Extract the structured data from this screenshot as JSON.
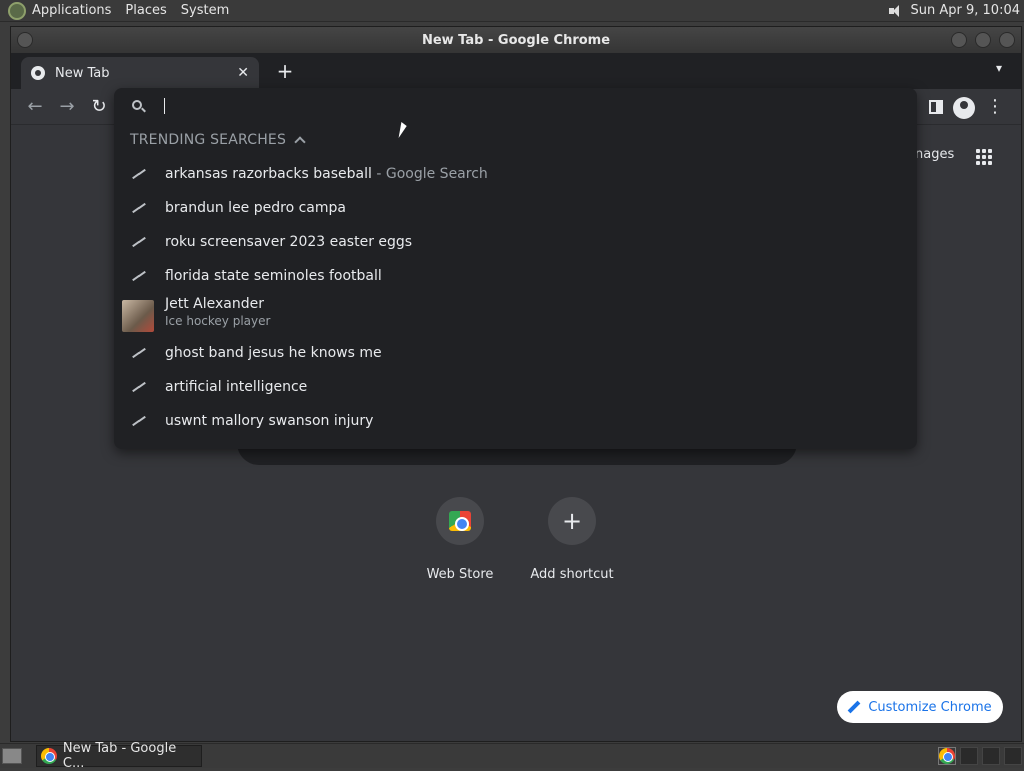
{
  "top_panel": {
    "menus": [
      "Applications",
      "Places",
      "System"
    ],
    "clock": "Sun Apr  9, 10:04"
  },
  "window": {
    "title": "New Tab - Google Chrome"
  },
  "tab": {
    "title": "New Tab"
  },
  "omnibox": {
    "value": "",
    "trending_header": "TRENDING SEARCHES",
    "suggestions": [
      {
        "text": "arkansas razorbacks baseball",
        "suffix": " - Google Search"
      },
      {
        "text": "brandun lee pedro campa"
      },
      {
        "text": "roku screensaver 2023 easter eggs"
      },
      {
        "text": "florida state seminoles football"
      },
      {
        "title": "Jett Alexander",
        "subtitle": "Ice hockey player"
      },
      {
        "text": "ghost band jesus he knows me"
      },
      {
        "text": "artificial intelligence"
      },
      {
        "text": "uswnt mallory swanson injury"
      }
    ]
  },
  "ntp": {
    "images_link": "nages",
    "shortcuts": [
      {
        "label": "Web Store"
      },
      {
        "label": "Add shortcut"
      }
    ],
    "customize_label": "Customize Chrome"
  },
  "taskbar": {
    "task_label": "New Tab - Google C..."
  }
}
